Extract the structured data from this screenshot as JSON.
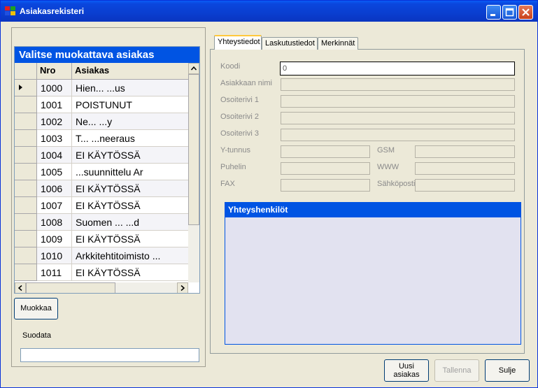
{
  "window": {
    "title": "Asiakasrekisteri"
  },
  "customer_list": {
    "title": "Valitse muokattava asiakas",
    "columns": [
      "Nro",
      "Asiakas"
    ],
    "rows": [
      {
        "nro": "1000",
        "name": "Hien... ...us"
      },
      {
        "nro": "1001",
        "name": "POISTUNUT"
      },
      {
        "nro": "1002",
        "name": "Ne... ...y"
      },
      {
        "nro": "1003",
        "name": "T... ...neeraus"
      },
      {
        "nro": "1004",
        "name": "EI KÄYTÖSSÄ"
      },
      {
        "nro": "1005",
        "name": "...suunnittelu Ar"
      },
      {
        "nro": "1006",
        "name": "EI KÄYTÖSSÄ"
      },
      {
        "nro": "1007",
        "name": "EI KÄYTÖSSÄ"
      },
      {
        "nro": "1008",
        "name": "Suomen ... ...d"
      },
      {
        "nro": "1009",
        "name": "EI KÄYTÖSSÄ"
      },
      {
        "nro": "1010",
        "name": "Arkkitehtitoimisto ..."
      },
      {
        "nro": "1011",
        "name": "EI KÄYTÖSSÄ"
      }
    ],
    "selected_index": 0
  },
  "buttons": {
    "edit": "Muokkaa",
    "new_customer_line1": "Uusi",
    "new_customer_line2": "asiakas",
    "save": "Tallenna",
    "close": "Sulje"
  },
  "filter": {
    "label": "Suodata",
    "value": ""
  },
  "tabs": [
    "Yhteystiedot",
    "Laskutustiedot",
    "Merkinnät"
  ],
  "active_tab": 0,
  "fields": {
    "koodi": {
      "label": "Koodi",
      "value": "0"
    },
    "name": {
      "label": "Asiakkaan nimi",
      "value": ""
    },
    "address1": {
      "label": "Osoiterivi 1",
      "value": ""
    },
    "address2": {
      "label": "Osoiterivi 2",
      "value": ""
    },
    "address3": {
      "label": "Osoiterivi 3",
      "value": ""
    },
    "ytunnus": {
      "label": "Y-tunnus",
      "value": ""
    },
    "gsm": {
      "label": "GSM",
      "value": ""
    },
    "phone": {
      "label": "Puhelin",
      "value": ""
    },
    "www": {
      "label": "WWW",
      "value": ""
    },
    "fax": {
      "label": "FAX",
      "value": ""
    },
    "email": {
      "label": "Sähköposti",
      "value": ""
    }
  },
  "contacts": {
    "title": "Yhteyshenkilöt"
  },
  "icons": {
    "app": "app-icon",
    "minimize": "minimize-icon",
    "maximize": "maximize-icon",
    "close": "close-icon",
    "row_pointer": "row-pointer-icon"
  },
  "colors": {
    "titlebar": "#0a46dd",
    "header_blue": "#0054e3",
    "window_bg": "#ece9d8",
    "contacts_bg": "#e2e2f0"
  }
}
